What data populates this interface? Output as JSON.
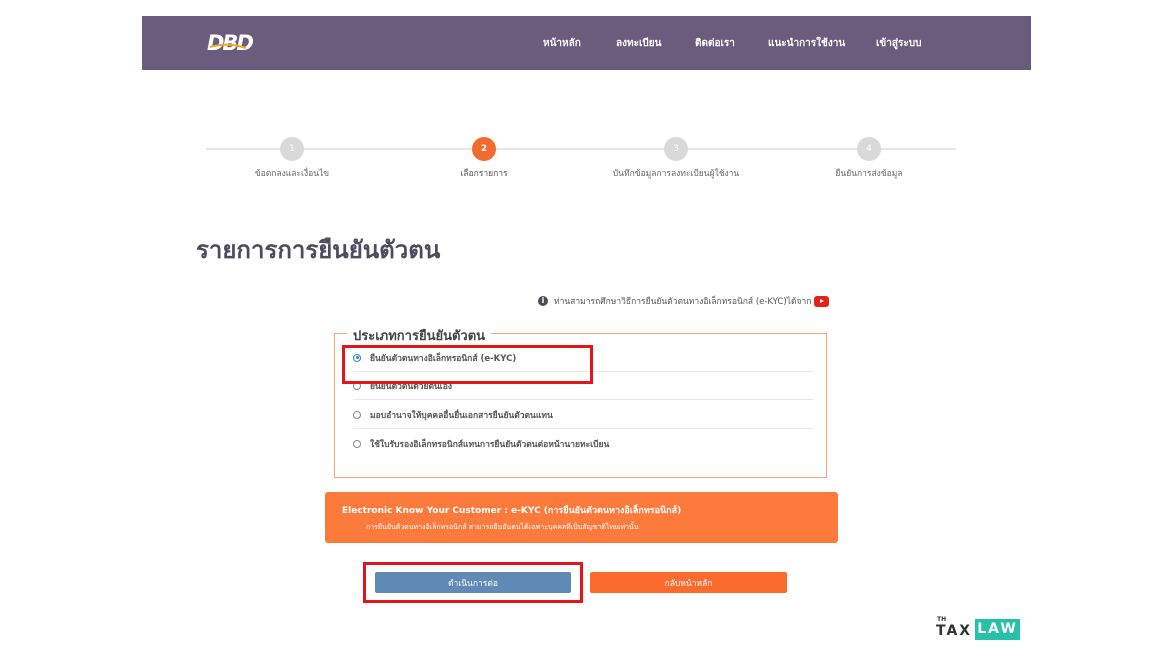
{
  "header": {
    "logo_text": "DBD",
    "nav": [
      {
        "label": "หน้าหลัก"
      },
      {
        "label": "ลงทะเบียน"
      },
      {
        "label": "ติดต่อเรา"
      },
      {
        "label": "แนะนำการใช้งาน"
      },
      {
        "label": "เข้าสู่ระบบ"
      }
    ]
  },
  "steps": [
    {
      "number": "1",
      "label": "ข้อตกลงและเงื่อนไข"
    },
    {
      "number": "2",
      "label": "เลือกรายการ",
      "active": true
    },
    {
      "number": "3",
      "label": "บันทึกข้อมูลการลงทะเบียนผู้ใช้งาน"
    },
    {
      "number": "4",
      "label": "ยืนยันการส่งข้อมูล"
    }
  ],
  "page_title": "รายการการยืนยันตัวตน",
  "help": {
    "icon": "info-icon",
    "text": "ท่านสามารถศึกษาวิธีการยืนยันตัวตนทางอิเล็กทรอนิกส์ (e-KYC)ได้จาก",
    "link_icon": "youtube-icon"
  },
  "verification": {
    "legend": "ประเภทการยืนยันตัวตน",
    "options": [
      {
        "label": "ยืนยันตัวตนทางอิเล็กทรอนิกส์ (e-KYC)",
        "selected": true
      },
      {
        "label": "ยืนยันตัวตนด้วยตนเอง",
        "selected": false
      },
      {
        "label": "มอบอำนาจให้บุคคลอื่นยื่นเอกสารยืนยันตัวตนแทน",
        "selected": false
      },
      {
        "label": "ใช้ใบรับรองอิเล็กทรอนิกส์แทนการยืนยันตัวตนต่อหน้านายทะเบียน",
        "selected": false
      }
    ]
  },
  "info_panel": {
    "title": "Electronic Know Your Customer : e-KYC (การยืนยันตัวตนทางอิเล็กทรอนิกส์)",
    "subtitle": "การยืนยันตัวตนทางอิเล็กทรอนิกส์ สามารถยืนยันตนได้เฉพาะบุคคลที่เป็นสัญชาติไทยเท่านั้น"
  },
  "buttons": {
    "continue": "ดำเนินการต่อ",
    "back": "กลับหน้าหลัก"
  },
  "watermark": {
    "th": "TH",
    "tax": "TAX",
    "law": "LAW"
  },
  "colors": {
    "header_bg": "#6b5b7d",
    "accent_orange": "#fd7a3d",
    "active_step": "#f36b2c",
    "continue_button": "#5f8ab5",
    "highlight_red": "#e3141b",
    "watermark_teal": "#27c1a9"
  }
}
